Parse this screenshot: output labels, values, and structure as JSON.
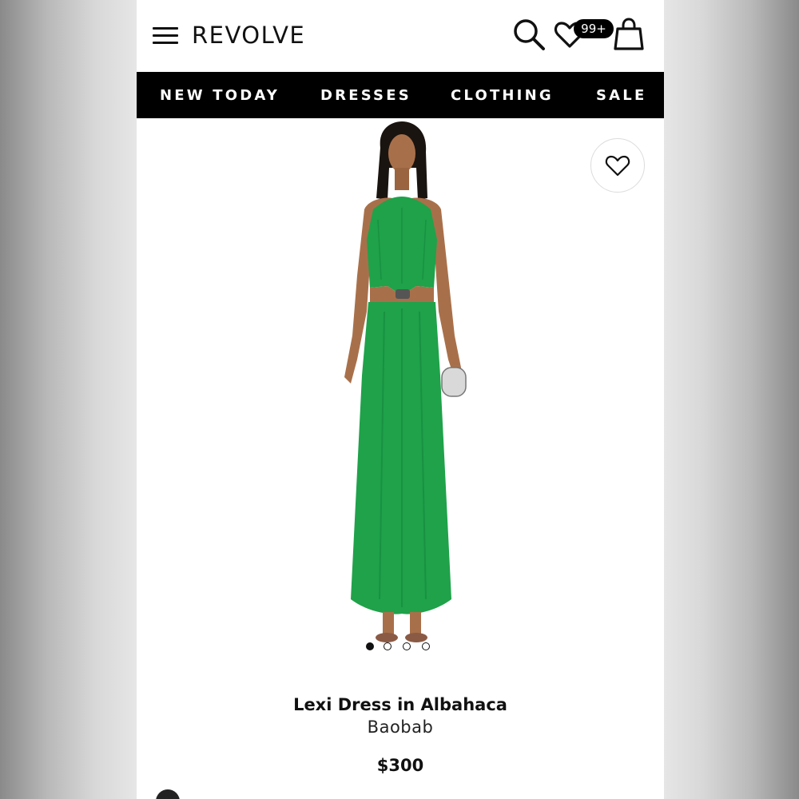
{
  "header": {
    "logo": "REVOLVE",
    "icons": [
      "menu-icon",
      "search-icon",
      "heart-icon",
      "shopping-bag-icon"
    ],
    "wishlist_badge": "99+"
  },
  "nav": {
    "items": [
      {
        "label": "NEW TODAY"
      },
      {
        "label": "DRESSES"
      },
      {
        "label": "CLOTHING"
      },
      {
        "label": "SALE"
      }
    ]
  },
  "product": {
    "name": "Lexi Dress in Albahaca",
    "brand": "Baobab",
    "price": "$300",
    "dress_color": "#1fa24a",
    "image_count": 4,
    "active_image": 1
  },
  "colors": {
    "header_bg": "#ffffff",
    "nav_bg": "#000000",
    "text": "#111111"
  }
}
